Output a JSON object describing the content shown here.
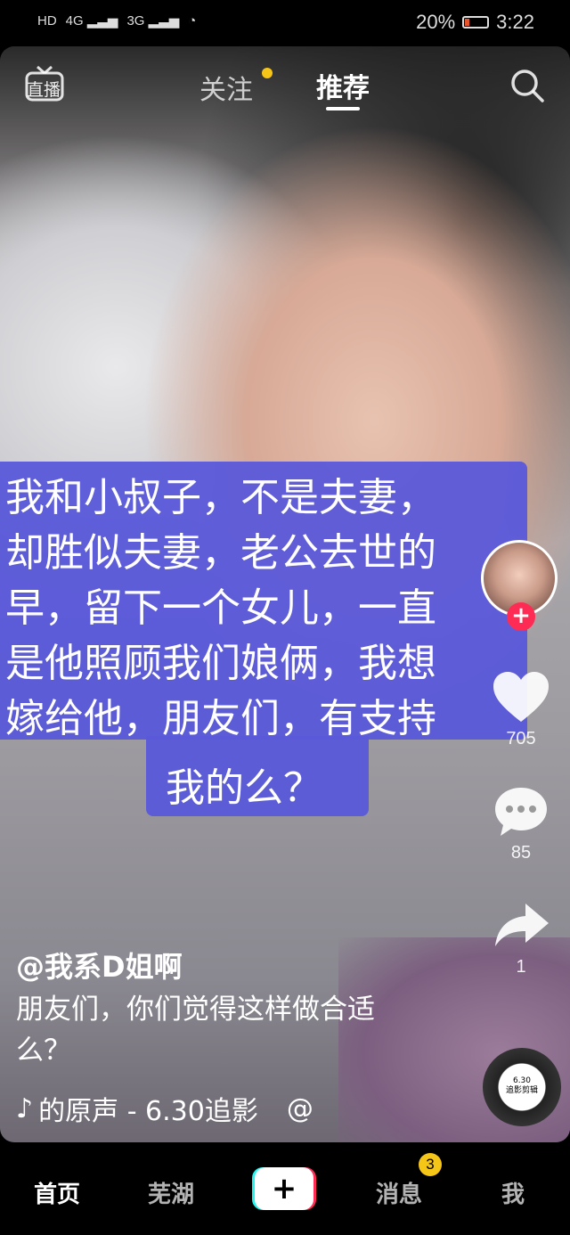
{
  "status_bar": {
    "left": [
      "HD",
      "4G",
      "3G"
    ],
    "battery": "20%",
    "battery_level": 0.2,
    "time": "3:22"
  },
  "top_tabs": {
    "live_label": "直播",
    "follow": "关注",
    "recommend": "推荐"
  },
  "caption": {
    "lines": "我和小叔子，不是夫妻，\n却胜似夫妻，老公去世的\n早，留下一个女儿，一直\n是他照顾我们娘俩，我想\n嫁给他，朋友们，有支持",
    "last_line": "我的么？"
  },
  "actions": {
    "likes": "705",
    "comments": "85",
    "shares": "1"
  },
  "post": {
    "author": "@我系D姐啊",
    "description": "朋友们，你们觉得这样做合适么？",
    "music": "的原声 - 6.30追影",
    "music_extra": "@",
    "disc_label_1": "6.30",
    "disc_label_2": "追影剪辑"
  },
  "bottom_nav": {
    "home": "首页",
    "city": "芜湖",
    "add": "+",
    "messages": "消息",
    "message_badge": "3",
    "me": "我"
  },
  "colors": {
    "caption_bg": "#5a58da",
    "accent_red": "#fe2c55",
    "badge_yellow": "#f5c518"
  }
}
